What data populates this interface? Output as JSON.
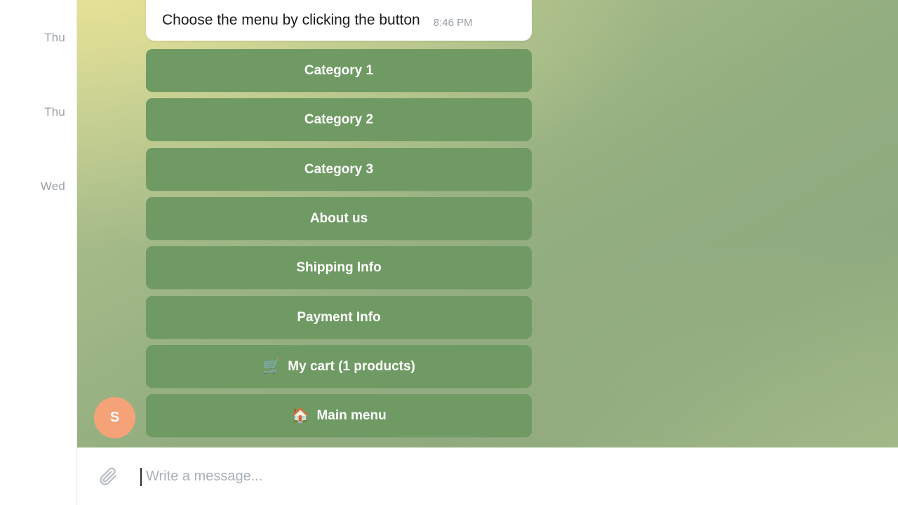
{
  "sidebar": {
    "dates": [
      {
        "label": "Thu"
      },
      {
        "label": "Thu"
      },
      {
        "label": "Wed"
      }
    ]
  },
  "chat": {
    "background_colors": {
      "top_left": "#d6db97",
      "mid": "#93ae80",
      "bottom_right": "#9ab383"
    },
    "message": {
      "text": "Choose the menu by clicking the button",
      "time": "8:46 PM"
    },
    "avatar": {
      "initial": "S",
      "color": "#f5a278"
    },
    "keyboard": {
      "button_color": "#709a64",
      "buttons": [
        {
          "emoji": "",
          "label": "Category 1"
        },
        {
          "emoji": "",
          "label": "Category 2"
        },
        {
          "emoji": "",
          "label": "Category 3"
        },
        {
          "emoji": "",
          "label": "About us"
        },
        {
          "emoji": "",
          "label": "Shipping Info"
        },
        {
          "emoji": "",
          "label": "Payment Info"
        },
        {
          "emoji": "🛒",
          "label": "My cart (1 products)"
        },
        {
          "emoji": "🏠",
          "label": "Main menu"
        }
      ]
    }
  },
  "composer": {
    "placeholder": "Write a message...",
    "value": "",
    "attach_icon": "paperclip-icon"
  }
}
